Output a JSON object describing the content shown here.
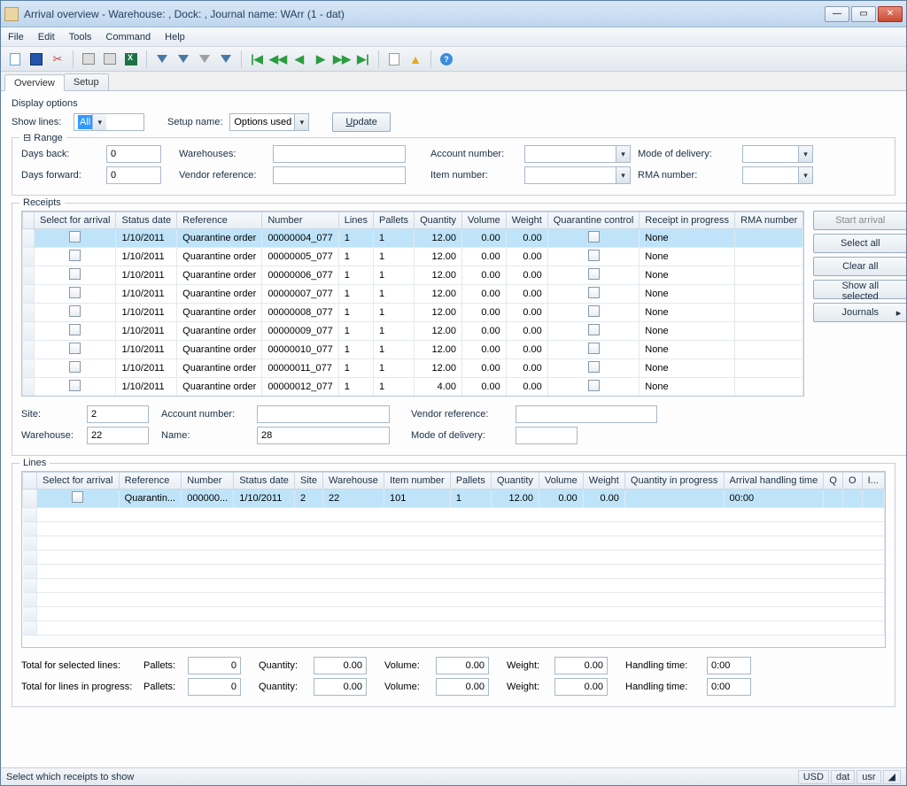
{
  "window": {
    "title": "Arrival overview - Warehouse: , Dock: , Journal name: WArr (1 - dat)"
  },
  "menu": [
    "File",
    "Edit",
    "Tools",
    "Command",
    "Help"
  ],
  "tabs": {
    "overview": "Overview",
    "setup": "Setup"
  },
  "display_options": {
    "legend": "Display options",
    "show_lines_label": "Show lines:",
    "show_lines_value": "All",
    "setup_name_label": "Setup name:",
    "setup_name_value": "Options used",
    "update_btn": "Update"
  },
  "range": {
    "legend": "Range",
    "days_back_label": "Days back:",
    "days_back_value": "0",
    "days_forward_label": "Days forward:",
    "days_forward_value": "0",
    "warehouses_label": "Warehouses:",
    "warehouses_value": "",
    "vendor_ref_label": "Vendor reference:",
    "vendor_ref_value": "",
    "account_no_label": "Account number:",
    "account_no_value": "",
    "item_no_label": "Item number:",
    "item_no_value": "",
    "mode_label": "Mode of delivery:",
    "mode_value": "",
    "rma_label": "RMA number:",
    "rma_value": ""
  },
  "receipts": {
    "legend": "Receipts",
    "side": {
      "start": "Start arrival",
      "select_all": "Select all",
      "clear_all": "Clear all",
      "show_sel": "Show all selected",
      "journals": "Journals"
    },
    "columns": [
      "Select for arrival",
      "Status date",
      "Reference",
      "Number",
      "Lines",
      "Pallets",
      "Quantity",
      "Volume",
      "Weight",
      "Quarantine control",
      "Receipt in progress",
      "RMA number"
    ],
    "rows": [
      {
        "date": "1/10/2011",
        "ref": "Quarantine order",
        "num": "00000004_077",
        "lines": "1",
        "pallets": "1",
        "qty": "12.00",
        "vol": "0.00",
        "wt": "0.00",
        "rip": "None"
      },
      {
        "date": "1/10/2011",
        "ref": "Quarantine order",
        "num": "00000005_077",
        "lines": "1",
        "pallets": "1",
        "qty": "12.00",
        "vol": "0.00",
        "wt": "0.00",
        "rip": "None"
      },
      {
        "date": "1/10/2011",
        "ref": "Quarantine order",
        "num": "00000006_077",
        "lines": "1",
        "pallets": "1",
        "qty": "12.00",
        "vol": "0.00",
        "wt": "0.00",
        "rip": "None"
      },
      {
        "date": "1/10/2011",
        "ref": "Quarantine order",
        "num": "00000007_077",
        "lines": "1",
        "pallets": "1",
        "qty": "12.00",
        "vol": "0.00",
        "wt": "0.00",
        "rip": "None"
      },
      {
        "date": "1/10/2011",
        "ref": "Quarantine order",
        "num": "00000008_077",
        "lines": "1",
        "pallets": "1",
        "qty": "12.00",
        "vol": "0.00",
        "wt": "0.00",
        "rip": "None"
      },
      {
        "date": "1/10/2011",
        "ref": "Quarantine order",
        "num": "00000009_077",
        "lines": "1",
        "pallets": "1",
        "qty": "12.00",
        "vol": "0.00",
        "wt": "0.00",
        "rip": "None"
      },
      {
        "date": "1/10/2011",
        "ref": "Quarantine order",
        "num": "00000010_077",
        "lines": "1",
        "pallets": "1",
        "qty": "12.00",
        "vol": "0.00",
        "wt": "0.00",
        "rip": "None"
      },
      {
        "date": "1/10/2011",
        "ref": "Quarantine order",
        "num": "00000011_077",
        "lines": "1",
        "pallets": "1",
        "qty": "12.00",
        "vol": "0.00",
        "wt": "0.00",
        "rip": "None"
      },
      {
        "date": "1/10/2011",
        "ref": "Quarantine order",
        "num": "00000012_077",
        "lines": "1",
        "pallets": "1",
        "qty": "4.00",
        "vol": "0.00",
        "wt": "0.00",
        "rip": "None"
      }
    ],
    "details": {
      "site_label": "Site:",
      "site": "2",
      "warehouse_label": "Warehouse:",
      "warehouse": "22",
      "account_label": "Account number:",
      "account": "",
      "name_label": "Name:",
      "name": "28",
      "vendor_label": "Vendor reference:",
      "vendor": "",
      "mode_label": "Mode of delivery:",
      "mode": ""
    }
  },
  "lines": {
    "legend": "Lines",
    "columns": [
      "Select for arrival",
      "Reference",
      "Number",
      "Status date",
      "Site",
      "Warehouse",
      "Item number",
      "Pallets",
      "Quantity",
      "Volume",
      "Weight",
      "Quantity in progress",
      "Arrival handling time",
      "Q",
      "O",
      "I..."
    ],
    "rows": [
      {
        "ref": "Quarantin...",
        "num": "000000...",
        "date": "1/10/2011",
        "site": "2",
        "wh": "22",
        "item": "101",
        "pallets": "1",
        "qty": "12.00",
        "vol": "0.00",
        "wt": "0.00",
        "qip": "",
        "aht": "00:00"
      }
    ]
  },
  "totals": {
    "sel_label": "Total for selected lines:",
    "prog_label": "Total for lines in progress:",
    "pallets_label": "Pallets:",
    "pallets_sel": "0",
    "pallets_prog": "0",
    "qty_label": "Quantity:",
    "qty_sel": "0.00",
    "qty_prog": "0.00",
    "vol_label": "Volume:",
    "vol_sel": "0.00",
    "vol_prog": "0.00",
    "wt_label": "Weight:",
    "wt_sel": "0.00",
    "wt_prog": "0.00",
    "ht_label": "Handling time:",
    "ht_sel": "0:00",
    "ht_prog": "0:00"
  },
  "status": {
    "text": "Select which receipts to show",
    "c1": "USD",
    "c2": "dat",
    "c3": "usr"
  }
}
